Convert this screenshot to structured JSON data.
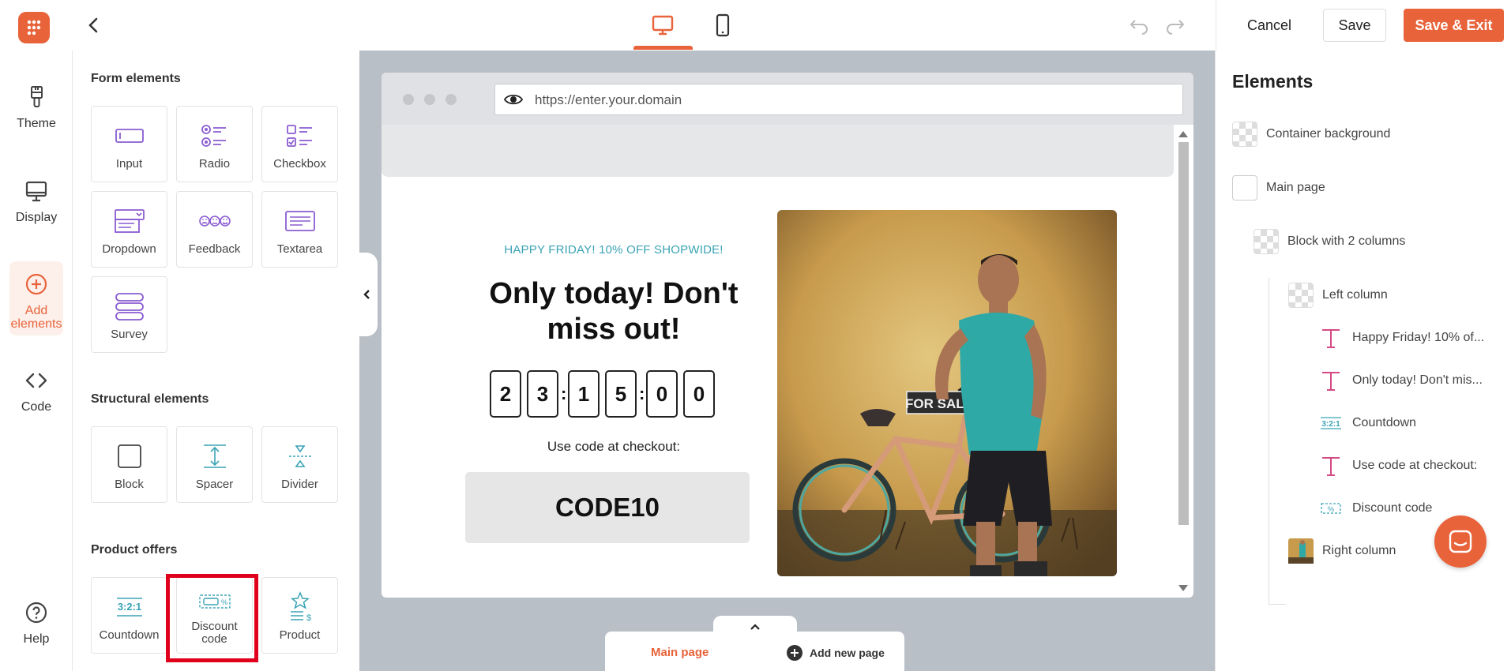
{
  "topbar": {
    "cancel_label": "Cancel",
    "save_label": "Save",
    "save_exit_label": "Save & Exit",
    "accent": "#e8633a"
  },
  "rail": {
    "items": [
      {
        "label": "Theme",
        "icon": "brush-icon"
      },
      {
        "label": "Display",
        "icon": "monitor-icon"
      },
      {
        "label": "Add elements",
        "icon": "plus-circle-icon"
      },
      {
        "label": "Code",
        "icon": "code-icon"
      },
      {
        "label": "Help",
        "icon": "help-icon"
      }
    ]
  },
  "panel": {
    "form_title": "Form elements",
    "form_items": [
      "Input",
      "Radio",
      "Checkbox",
      "Dropdown",
      "Feedback",
      "Textarea",
      "Survey"
    ],
    "structural_title": "Structural elements",
    "structural_items": [
      "Block",
      "Spacer",
      "Divider"
    ],
    "offers_title": "Product offers",
    "offer_items": [
      "Countdown",
      "Discount code",
      "Product"
    ]
  },
  "preview": {
    "url": "https://enter.your.domain",
    "pre_headline": "HAPPY FRIDAY! 10% OFF SHOPWIDE!",
    "headline": "Only today! Don't miss out!",
    "countdown_digits": [
      "2",
      "3",
      "1",
      "5",
      "0",
      "0"
    ],
    "countdown_sep": ":",
    "use_code_text": "Use code at checkout:",
    "code": "CODE10",
    "photo_sign": "FOR SALE"
  },
  "pages": {
    "main_label": "Main page",
    "add_label": "Add new page"
  },
  "elements_panel": {
    "title": "Elements",
    "rows": [
      "Container background",
      "Main page",
      "Block with 2 columns",
      "Left column",
      "Happy Friday! 10% of...",
      "Only today! Don't mis...",
      "Countdown",
      "Use code at checkout:",
      "Discount code",
      "Right column"
    ]
  }
}
